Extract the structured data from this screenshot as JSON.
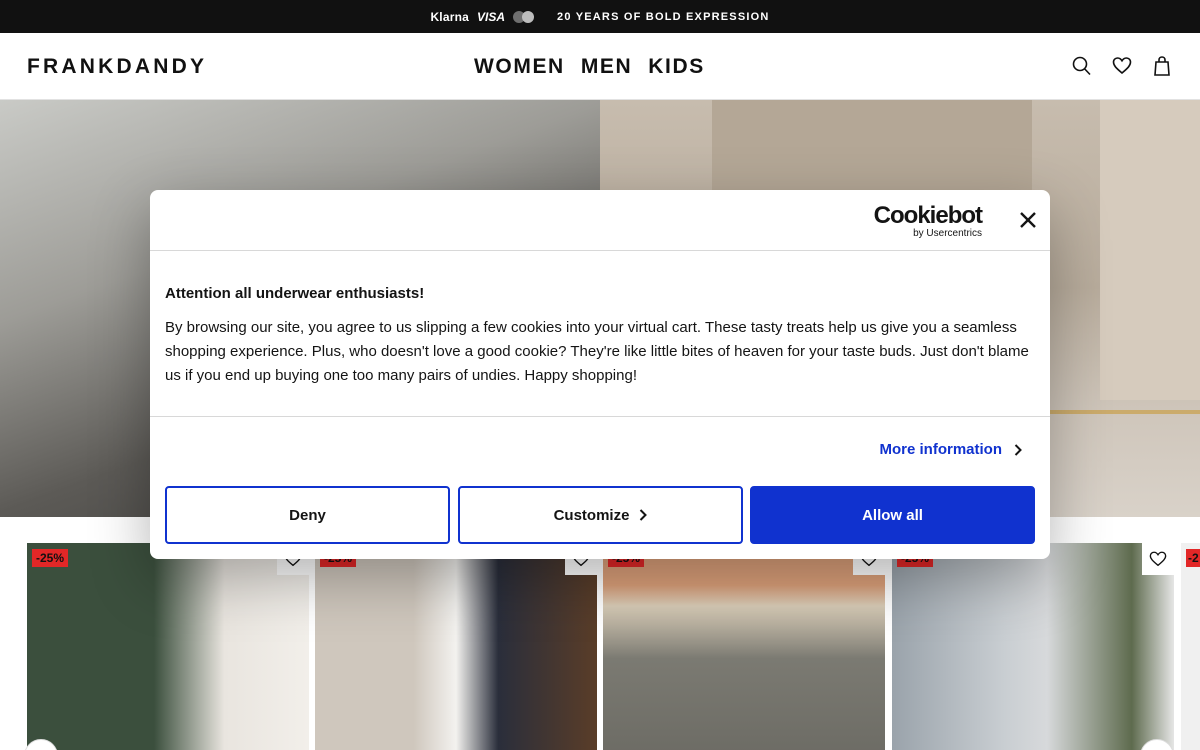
{
  "topbar": {
    "klarna": "Klarna",
    "visa": "VISA",
    "promo": "20 YEARS OF BOLD EXPRESSION"
  },
  "header": {
    "logo": "FRANKDANDY",
    "nav": [
      "WOMEN",
      "MEN",
      "KIDS"
    ],
    "icons": [
      "search-icon",
      "heart-icon",
      "bag-icon"
    ]
  },
  "products": [
    {
      "badge": "-25%",
      "colors": [
        "#3b4f3d",
        "#e9e5df"
      ]
    },
    {
      "badge": "-25%",
      "colors": [
        "#cfc7bd",
        "#2a2e3b"
      ]
    },
    {
      "badge": "-25%",
      "colors": [
        "#dca07a",
        "#7b7a72"
      ]
    },
    {
      "badge": "-25%",
      "colors": [
        "#9aa3ab",
        "#d7d9db"
      ]
    }
  ],
  "cookie_dialog": {
    "brand": "Cookiebot",
    "brand_sub": "by Usercentrics",
    "title": "Attention all underwear enthusiasts!",
    "text": "By browsing our site, you agree to us slipping a few cookies into your virtual cart. These tasty treats help us give you a seamless shopping experience. Plus, who doesn't love a good cookie? They're like little bites of heaven for your taste buds. Just don't blame us if you end up buying one too many pairs of undies. Happy shopping!",
    "more_info": "More information",
    "buttons": {
      "deny": "Deny",
      "customize": "Customize",
      "allow_all": "Allow all"
    }
  },
  "colors": {
    "accent": "#1032cf",
    "badge": "#e22727",
    "topbar": "#111111"
  }
}
